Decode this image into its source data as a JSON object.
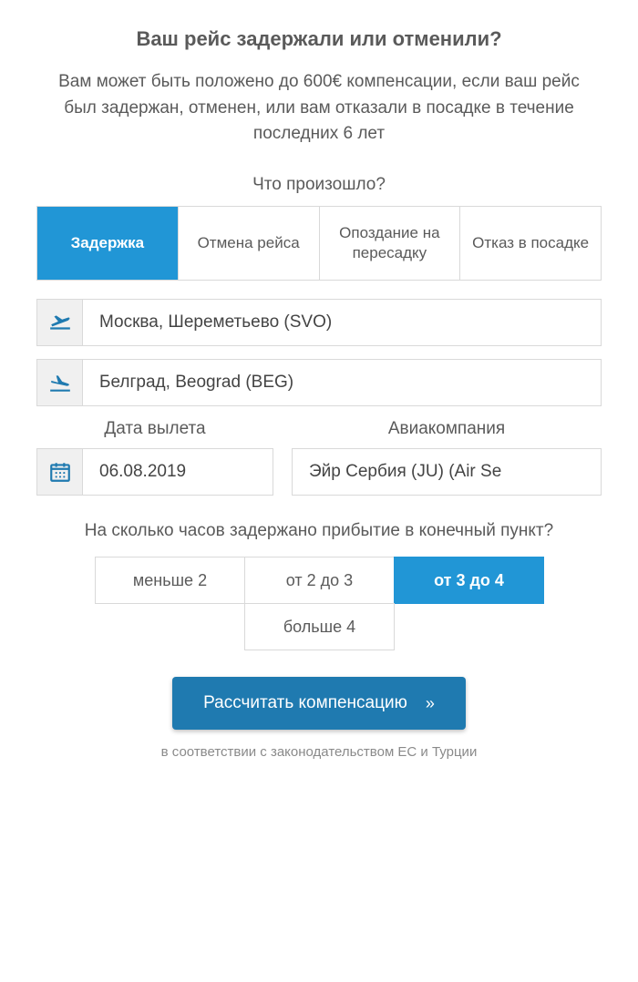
{
  "title": "Ваш рейс задержали или отменили?",
  "subtitle": "Вам может быть положено до 600€ компенсации, если ваш рейс был задержан, отменен, или вам отказали в посадке в течение последних 6 лет",
  "what_happened": {
    "label": "Что произошло?",
    "tabs": [
      {
        "label": "Задержка",
        "active": true
      },
      {
        "label": "Отмена рейса",
        "active": false
      },
      {
        "label": "Опоздание на пересадку",
        "active": false
      },
      {
        "label": "Отказ в посадке",
        "active": false
      }
    ]
  },
  "departure": {
    "value": "Москва, Шереметьево (SVO)"
  },
  "arrival": {
    "value": "Белград, Beograd (BEG)"
  },
  "date": {
    "label": "Дата вылета",
    "value": "06.08.2019"
  },
  "airline": {
    "label": "Авиакомпания",
    "value": "Эйр Сербия (JU) (Air Se"
  },
  "delay": {
    "question": "На сколько часов задержано прибытие в конечный пункт?",
    "options": [
      {
        "label": "меньше 2",
        "active": false
      },
      {
        "label": "от 2 до 3",
        "active": false
      },
      {
        "label": "от 3 до 4",
        "active": true
      },
      {
        "label": "больше 4",
        "active": false
      }
    ]
  },
  "cta": {
    "label": "Рассчитать компенсацию",
    "arrow": "»"
  },
  "footnote": "в соответствии с законодательством ЕС и Турции",
  "colors": {
    "accent": "#2196d6",
    "cta": "#1f7ab0"
  }
}
